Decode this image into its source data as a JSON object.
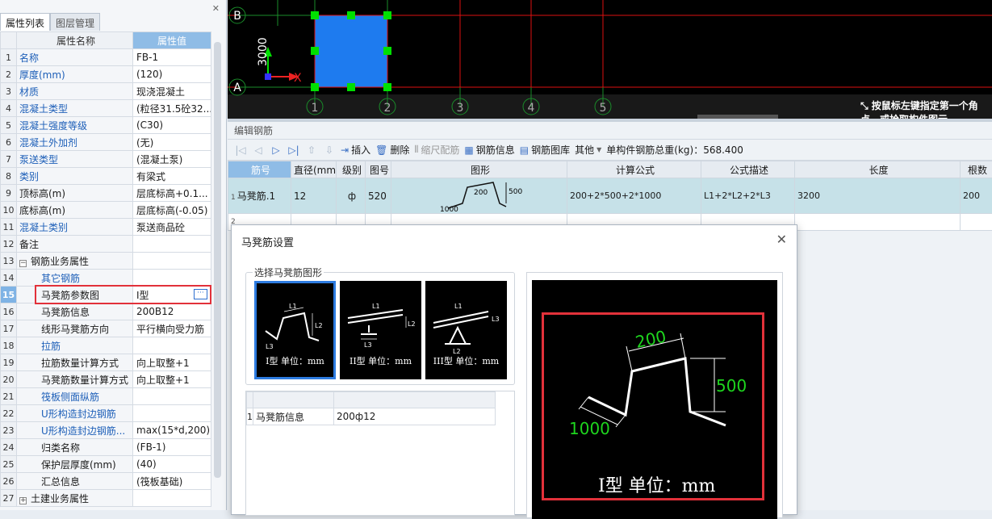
{
  "left_panel": {
    "tabs": [
      "属性列表",
      "图层管理"
    ],
    "pin_icon": "pin-icon",
    "header": {
      "col_name": "属性名称",
      "col_value": "属性值"
    },
    "rows": [
      {
        "num": "1",
        "name": "名称",
        "value": "FB-1",
        "blue": true
      },
      {
        "num": "2",
        "name": "厚度(mm)",
        "value": "(120)",
        "blue": true
      },
      {
        "num": "3",
        "name": "材质",
        "value": "现浇混凝土",
        "blue": true
      },
      {
        "num": "4",
        "name": "混凝土类型",
        "value": "(粒径31.5砼32...",
        "blue": true
      },
      {
        "num": "5",
        "name": "混凝土强度等级",
        "value": "(C30)",
        "blue": true
      },
      {
        "num": "6",
        "name": "混凝土外加剂",
        "value": "(无)",
        "blue": true
      },
      {
        "num": "7",
        "name": "泵送类型",
        "value": "(混凝土泵)",
        "blue": true
      },
      {
        "num": "8",
        "name": "类别",
        "value": "有梁式",
        "blue": true
      },
      {
        "num": "9",
        "name": "顶标高(m)",
        "value": "层底标高+0.1...",
        "blue": false
      },
      {
        "num": "10",
        "name": "底标高(m)",
        "value": "层底标高(-0.05)",
        "blue": false
      },
      {
        "num": "11",
        "name": "混凝土类别",
        "value": "泵送商品砼",
        "blue": true
      },
      {
        "num": "12",
        "name": "备注",
        "value": "",
        "blue": false
      },
      {
        "num": "13",
        "name": "钢筋业务属性",
        "value": "",
        "blue": false,
        "expander": "−"
      },
      {
        "num": "14",
        "name": "其它钢筋",
        "value": "",
        "blue": true,
        "indent": true
      },
      {
        "num": "15",
        "name": "马凳筋参数图",
        "value": "Ⅰ型",
        "blue": false,
        "indent": true,
        "selected": true
      },
      {
        "num": "16",
        "name": "马凳筋信息",
        "value": "200B12",
        "blue": false,
        "indent": true
      },
      {
        "num": "17",
        "name": "线形马凳筋方向",
        "value": "平行横向受力筋",
        "blue": false,
        "indent": true
      },
      {
        "num": "18",
        "name": "拉筋",
        "value": "",
        "blue": true,
        "indent": true
      },
      {
        "num": "19",
        "name": "拉筋数量计算方式",
        "value": "向上取整+1",
        "blue": false,
        "indent": true
      },
      {
        "num": "20",
        "name": "马凳筋数量计算方式",
        "value": "向上取整+1",
        "blue": false,
        "indent": true
      },
      {
        "num": "21",
        "name": "筏板侧面纵筋",
        "value": "",
        "blue": true,
        "indent": true
      },
      {
        "num": "22",
        "name": "U形构造封边钢筋",
        "value": "",
        "blue": true,
        "indent": true
      },
      {
        "num": "23",
        "name": "U形构造封边钢筋...",
        "value": "max(15*d,200)",
        "blue": true,
        "indent": true
      },
      {
        "num": "24",
        "name": "归类名称",
        "value": "(FB-1)",
        "blue": false,
        "indent": true
      },
      {
        "num": "25",
        "name": "保护层厚度(mm)",
        "value": "(40)",
        "blue": false,
        "indent": true
      },
      {
        "num": "26",
        "name": "汇总信息",
        "value": "(筏板基础)",
        "blue": false,
        "indent": true
      },
      {
        "num": "27",
        "name": "土建业务属性",
        "value": "",
        "blue": false,
        "expander": "+"
      }
    ]
  },
  "cad": {
    "axis_rows": [
      "B",
      "A"
    ],
    "axis_cols": [
      "1",
      "2",
      "3",
      "4",
      "5"
    ],
    "dimension": "3000",
    "axis_x_label": "X",
    "status_icon": "cursor-icon",
    "status_text": "按鼠标左键指定第一个角点，或拾取构件图元"
  },
  "editor": {
    "title": "编辑钢筋",
    "toolbar": {
      "insert": "插入",
      "delete": "删除",
      "scale": "缩尺配筋",
      "rebar_info": "钢筋信息",
      "rebar_lib": "钢筋图库",
      "other": "其他",
      "total": "单构件钢筋总重(kg)：568.400"
    },
    "headers": [
      "筋号",
      "直径(mm)",
      "级别",
      "图号",
      "图形",
      "计算公式",
      "公式描述",
      "长度",
      "根数"
    ],
    "row": {
      "num": "1",
      "name": "马凳筋.1",
      "diameter": "12",
      "grade": "ф",
      "figure_no": "520",
      "dim_a": "200",
      "dim_b": "500",
      "dim_c": "1000",
      "formula": "200+2*500+2*1000",
      "desc": "L1+2*L2+2*L3",
      "length": "3200",
      "count": "200"
    },
    "row2_num": "2"
  },
  "dialog": {
    "title": "马凳筋设置",
    "group_label": "选择马凳筋图形",
    "thumbs": [
      {
        "caption": "I型 单位：mm",
        "l1": "L1",
        "l2": "L2",
        "l3": "L3"
      },
      {
        "caption": "II型 单位：mm",
        "l1": "L1",
        "l2": "L2",
        "l3": "L3"
      },
      {
        "caption": "III型 单位：mm",
        "l1": "L1",
        "l2": "L2",
        "l3": "L3"
      }
    ],
    "info_row": {
      "num": "1",
      "name": "马凳筋信息",
      "value": "200ф12"
    },
    "preview": {
      "dim1": "200",
      "dim2": "500",
      "dim3": "1000",
      "caption": "I型 单位：mm"
    }
  }
}
